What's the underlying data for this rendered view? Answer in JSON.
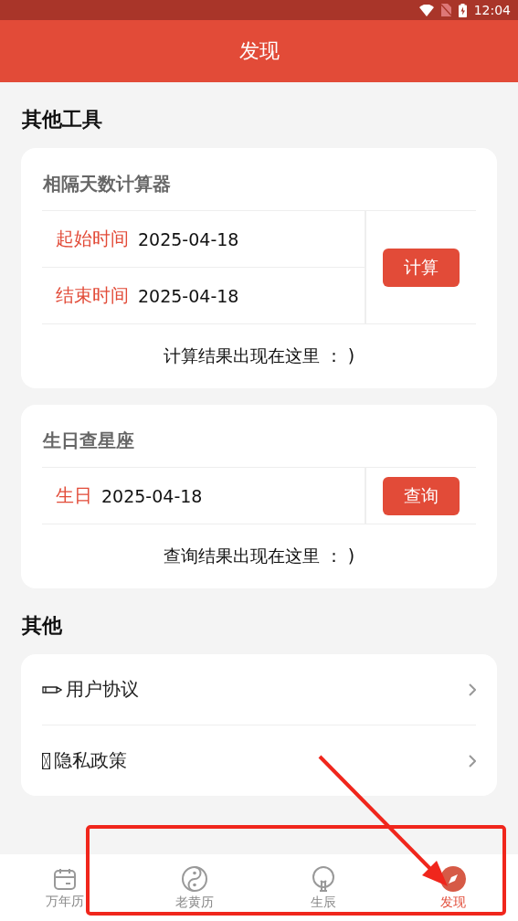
{
  "status_bar": {
    "time": "12:04"
  },
  "title": "发现",
  "tools": {
    "heading": "其他工具",
    "cards": [
      {
        "title": "相隔天数计算器",
        "fields": [
          {
            "label": "起始时间",
            "value": "2025-04-18"
          },
          {
            "label": "结束时间",
            "value": "2025-04-18"
          }
        ],
        "button": "计算",
        "result": "计算结果出现在这里 ： )"
      },
      {
        "title": "生日查星座",
        "fields": [
          {
            "label": "生日",
            "value": "2025-04-18"
          }
        ],
        "button": "查询",
        "result": "查询结果出现在这里 ： )"
      }
    ]
  },
  "others": {
    "heading": "其他",
    "items": [
      {
        "label": "用户协议",
        "kind": "pencil"
      },
      {
        "label": "隐私政策",
        "kind": "missing"
      }
    ]
  },
  "tabs": [
    {
      "label": "万年历",
      "kind": "calendar",
      "selected": false
    },
    {
      "label": "老黄历",
      "kind": "yinyang",
      "selected": false
    },
    {
      "label": "生辰",
      "kind": "tree",
      "selected": false
    },
    {
      "label": "发现",
      "kind": "compass",
      "selected": true
    }
  ]
}
